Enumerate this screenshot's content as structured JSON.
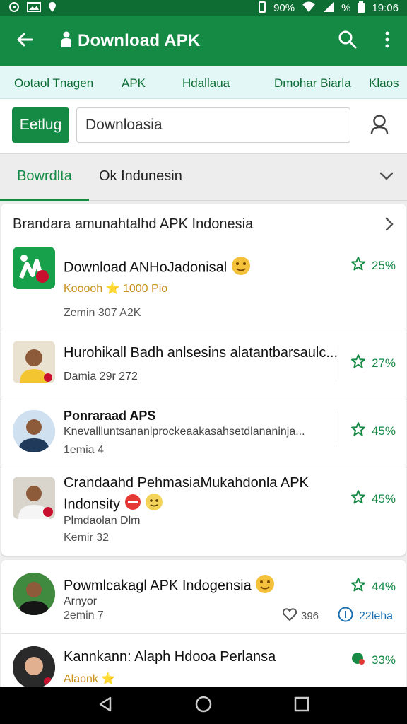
{
  "status_bar": {
    "time": "19:06",
    "signal_text": "90%",
    "battery_text": "%"
  },
  "app_bar": {
    "title": "Download APK"
  },
  "chips": [
    "Ootaol Tnagen",
    "APK",
    "Hdallaua",
    "Dmohar Biarla",
    "Klaos"
  ],
  "search": {
    "button_label": "Eetlug",
    "value": "Downloasia"
  },
  "tabs": {
    "active": "Bowrdlta",
    "second": "Ok Indunesin"
  },
  "section": {
    "title": "Brandara amunahtalhd APK Indonesia"
  },
  "items": [
    {
      "title": "Download ANHoJadonisal",
      "sub": "Kooooh ⭐ 1000 Pio",
      "meta": "Zemin 307 A2K",
      "rating": "25%"
    },
    {
      "title": "Hurohikall Badh anlsesins alatantbarsaulc...",
      "sub": "Damia 29r 272",
      "rating": "27%"
    },
    {
      "title": "Ponraraad APS",
      "sub": "Knevallluntsananlprockeaakasahsetdlananinja...",
      "meta": "1emia  4",
      "rating": "45%"
    },
    {
      "title": "Crandaahd PehmasiaMukahdonla APK Indonsity",
      "sub": "Plmdaolan Dlm",
      "meta": "Kemir 32",
      "rating": "45%"
    },
    {
      "title": "Powmlcakagl APK Indogensia",
      "sub": "Arnyor",
      "meta": "2emin  7",
      "likes": "396",
      "views": "22leha",
      "rating": "44%"
    },
    {
      "title": "Kannkann: Alaph Hdooa Perlansa",
      "sub": "Alaonk ⭐",
      "rating": "33%"
    }
  ],
  "colors": {
    "primary": "#148a45",
    "status_bar": "#0e6d33",
    "chip_bar": "#e2f7f6",
    "rating_green": "#148a45"
  }
}
